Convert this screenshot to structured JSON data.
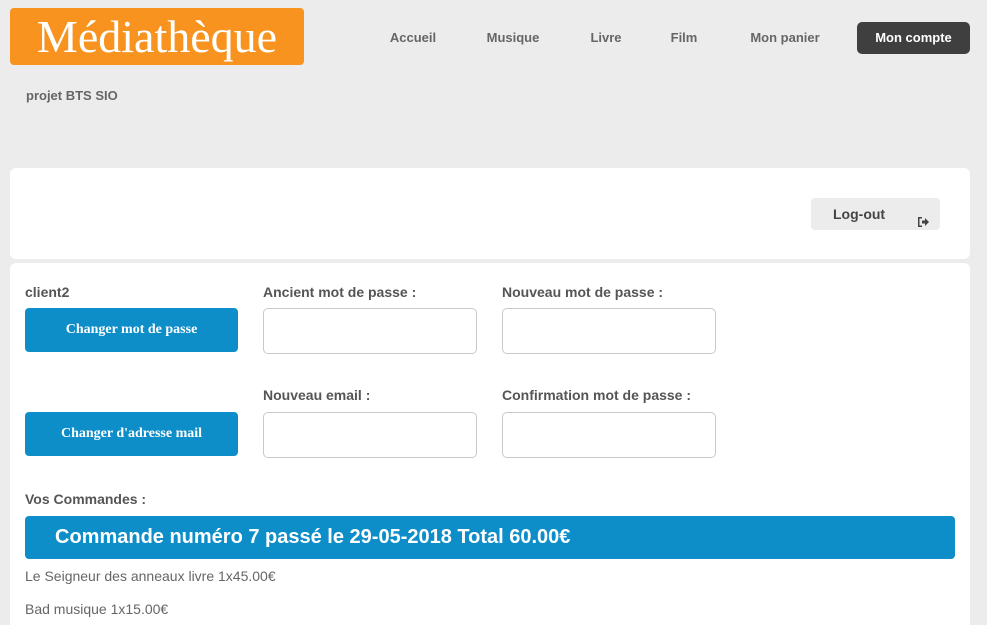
{
  "header": {
    "logo": "Médiathèque",
    "subtitle": "projet BTS SIO"
  },
  "nav": {
    "items": [
      {
        "label": "Accueil"
      },
      {
        "label": "Musique"
      },
      {
        "label": "Livre"
      },
      {
        "label": "Film"
      },
      {
        "label": "Mon panier"
      },
      {
        "label": "Mon compte",
        "active": true
      }
    ]
  },
  "account": {
    "logout_label": "Log-out",
    "username": "client2",
    "change_password_button": "Changer mot de passe",
    "change_email_button": "Changer d'adresse mail",
    "old_password_label": "Ancient mot de passe :",
    "new_password_label": "Nouveau mot de passe :",
    "new_email_label": "Nouveau email :",
    "confirm_password_label": "Confirmation mot de passe :",
    "old_password_value": "",
    "new_password_value": "",
    "new_email_value": "",
    "confirm_password_value": ""
  },
  "orders": {
    "heading": "Vos Commandes :",
    "items": [
      {
        "title": "Commande numéro 7 passé le 29-05-2018 Total 60.00€",
        "lines": [
          "Le Seigneur des anneaux livre 1x45.00€",
          "Bad musique 1x15.00€"
        ]
      }
    ]
  },
  "colors": {
    "logo_bg": "#f7931e",
    "accent_blue": "#0d8ec9",
    "active_nav_bg": "#3f3f3f"
  }
}
